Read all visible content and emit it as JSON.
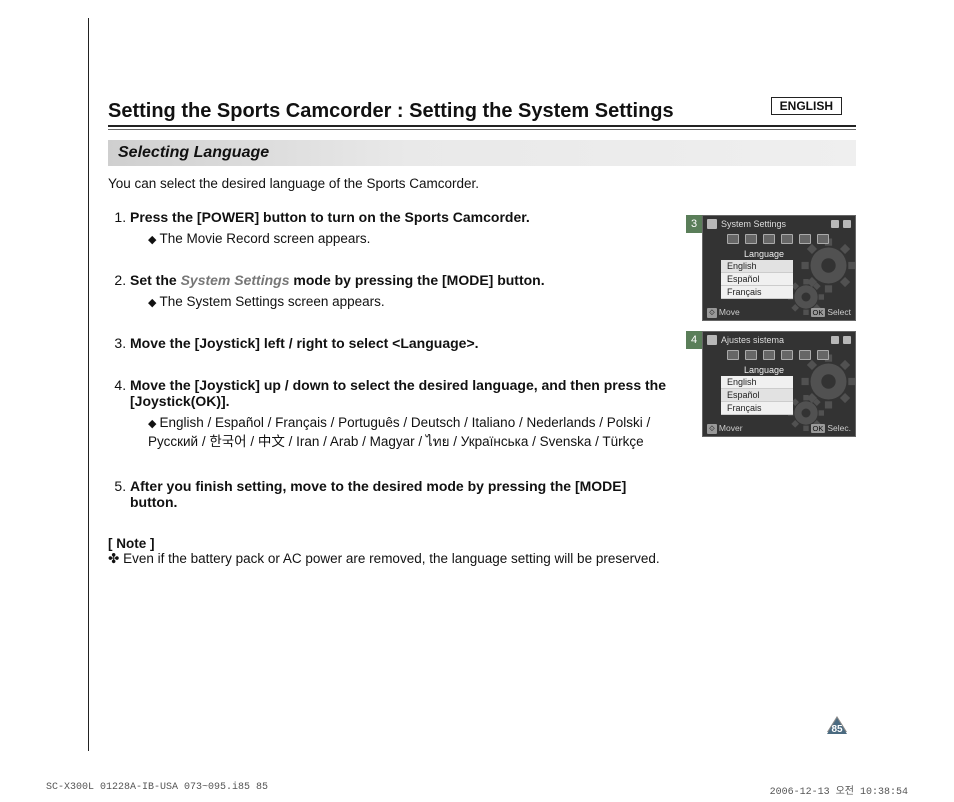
{
  "lang_label": "ENGLISH",
  "title": "Setting the Sports Camcorder : Setting the System Settings",
  "section": "Selecting Language",
  "intro": "You can select the desired language of the Sports Camcorder.",
  "steps": [
    {
      "text": "Press the [POWER] button to turn on the Sports Camcorder.",
      "bullets": [
        "The Movie Record screen appears."
      ]
    },
    {
      "pre": "Set the ",
      "grey": "System Settings",
      "post": " mode by pressing the [MODE] button.",
      "bullets": [
        "The System Settings screen appears."
      ]
    },
    {
      "text": "Move the [Joystick] left / right to select <Language>.",
      "bullets": []
    },
    {
      "text": "Move the [Joystick] up / down to select the desired language, and then press the [Joystick(OK)].",
      "bullets": [
        "English / Español / Français / Português / Deutsch / Italiano / Nederlands / Polski / Русский /  한국어  /  中文  / Iran / Arab / Magyar / ไทย / Українська / Svenska / Türkçe"
      ]
    },
    {
      "text": "After you finish setting, move to the desired mode by pressing the [MODE] button.",
      "bullets": []
    }
  ],
  "note_label": "[ Note ]",
  "note_text": "Even if the battery pack or AC power are removed, the language setting will be preserved.",
  "shots": [
    {
      "num": "3",
      "title": "System Settings",
      "tab": "Language",
      "options": [
        "English",
        "Español",
        "Français"
      ],
      "bot_left": "Move",
      "bot_left_key": "⟐",
      "bot_right_key": "OK",
      "bot_right": "Select"
    },
    {
      "num": "4",
      "title": "Ajustes sistema",
      "tab": "Language",
      "options": [
        "English",
        "Español",
        "Français"
      ],
      "bot_left": "Mover",
      "bot_left_key": "⟐",
      "bot_right_key": "OK",
      "bot_right": "Selec."
    }
  ],
  "page_num": "85",
  "footer_left": "SC-X300L 01228A-IB-USA 073~095.i85   85",
  "footer_right": "2006-12-13   오전 10:38:54"
}
